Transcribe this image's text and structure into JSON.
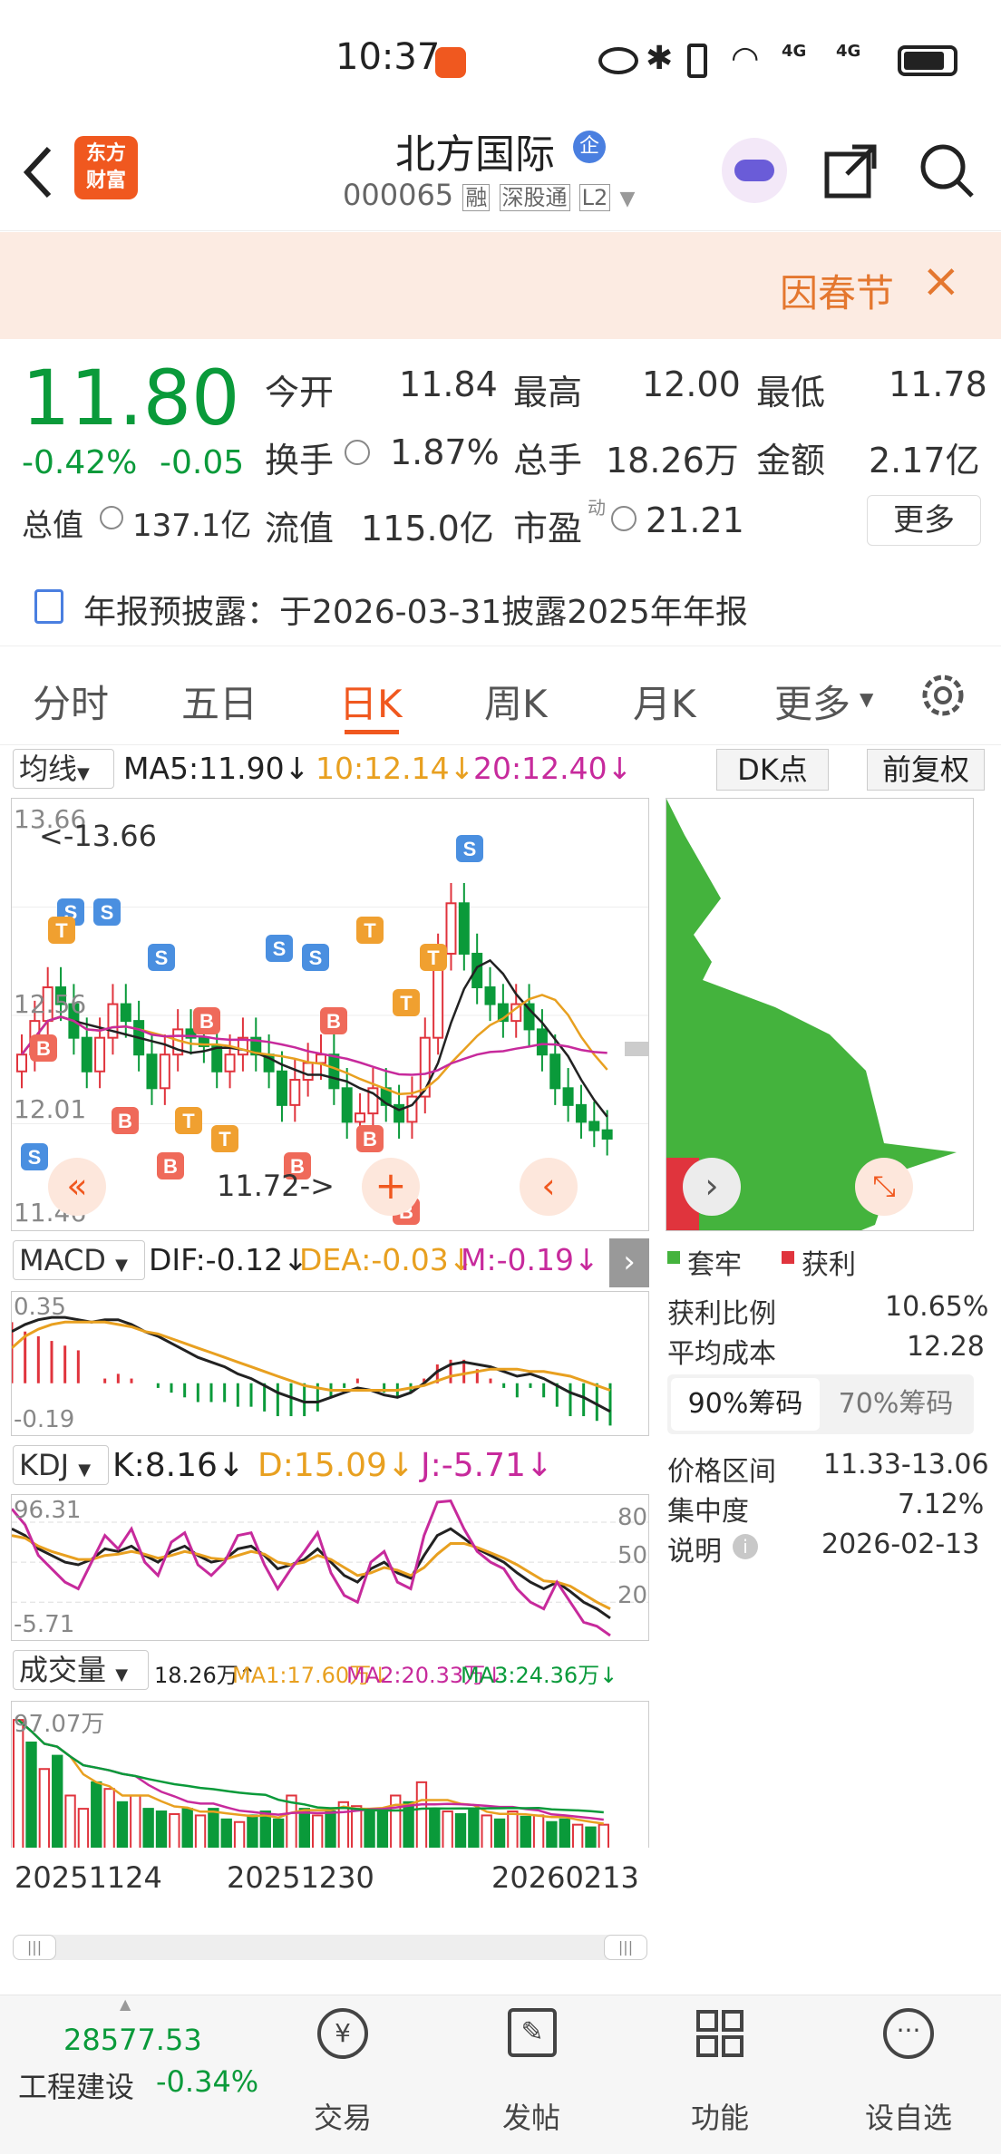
{
  "status_bar": {
    "time": "10:37",
    "signal_labels": [
      "4G",
      "4G"
    ]
  },
  "header": {
    "app_logo": [
      "东方",
      "财富"
    ],
    "stock_name": "北方国际",
    "enterprise_badge": "企",
    "stock_code": "000065",
    "tags": [
      "融",
      "深股通",
      "L2"
    ]
  },
  "notice": {
    "text": "因春节",
    "close": "×"
  },
  "quote": {
    "price": "11.80",
    "change_pct": "-0.42%",
    "change": "-0.05",
    "fields": {
      "open_label": "今开",
      "open": "11.84",
      "high_label": "最高",
      "high": "12.00",
      "low_label": "最低",
      "low": "11.78",
      "turnover_label": "换手",
      "turnover": "1.87%",
      "volume_label": "总手",
      "volume": "18.26万",
      "amount_label": "金额",
      "amount": "2.17亿",
      "mcap_label": "总值",
      "mcap": "137.1亿",
      "float_label": "流值",
      "float": "115.0亿",
      "pe_label": "市盈",
      "pe_sup": "动",
      "pe": "21.21"
    },
    "more_button": "更多"
  },
  "report": {
    "text": "年报预披露：于2026-03-31披露2025年年报"
  },
  "tabs": [
    {
      "label": "分时",
      "active": false
    },
    {
      "label": "五日",
      "active": false
    },
    {
      "label": "日K",
      "active": true
    },
    {
      "label": "周K",
      "active": false
    },
    {
      "label": "月K",
      "active": false
    },
    {
      "label": "更多",
      "active": false
    }
  ],
  "ma_bar": {
    "selector": "均线",
    "ma5": "MA5:11.90↓",
    "ma10": "10:12.14↓",
    "ma20": "20:12.40↓",
    "dk_button": "DK点",
    "adjust_button": "前复权"
  },
  "kline": {
    "top_label": "13.66",
    "max_marker": "<-13.66",
    "mid_label": "12.56",
    "low_mid_label": "12.01",
    "bottom_label": "11.46",
    "cursor_label": "11.72->",
    "signal_s": "S",
    "signal_b": "B",
    "signal_t": "T"
  },
  "chips": {
    "legend_trapped": "套牢",
    "legend_profit": "获利",
    "profit_ratio_label": "获利比例",
    "profit_ratio": "10.65%",
    "avg_cost_label": "平均成本",
    "avg_cost": "12.28",
    "tab90": "90%筹码",
    "tab70": "70%筹码",
    "range_label": "价格区间",
    "range": "11.33-13.06",
    "conc_label": "集中度",
    "conc": "7.12%",
    "note_label": "说明",
    "note": "2026-02-13"
  },
  "macd": {
    "selector": "MACD",
    "dif": "DIF:-0.12↓",
    "dea": "DEA:-0.03↓",
    "m": "M:-0.19↓",
    "top": "0.35",
    "bottom": "-0.19",
    "dif_line": [
      0.22,
      0.25,
      0.27,
      0.28,
      0.28,
      0.27,
      0.26,
      0.27,
      0.27,
      0.25,
      0.22,
      0.2,
      0.17,
      0.14,
      0.11,
      0.09,
      0.07,
      0.04,
      0.02,
      -0.01,
      -0.04,
      -0.06,
      -0.08,
      -0.08,
      -0.06,
      -0.04,
      -0.02,
      -0.03,
      -0.05,
      -0.06,
      -0.04,
      0.0,
      0.05,
      0.08,
      0.09,
      0.08,
      0.07,
      0.05,
      0.03,
      0.04,
      0.02,
      -0.01,
      -0.04,
      -0.06,
      -0.09,
      -0.12
    ],
    "dea_line": [
      0.15,
      0.2,
      0.23,
      0.25,
      0.26,
      0.26,
      0.26,
      0.26,
      0.25,
      0.24,
      0.22,
      0.21,
      0.19,
      0.17,
      0.15,
      0.13,
      0.11,
      0.09,
      0.07,
      0.05,
      0.03,
      0.01,
      -0.01,
      -0.02,
      -0.03,
      -0.03,
      -0.03,
      -0.03,
      -0.03,
      -0.03,
      -0.02,
      -0.01,
      0.01,
      0.03,
      0.04,
      0.05,
      0.06,
      0.06,
      0.06,
      0.05,
      0.05,
      0.04,
      0.03,
      0.01,
      -0.01,
      -0.03
    ]
  },
  "kdj": {
    "selector": "KDJ",
    "k": "K:8.16↓",
    "d": "D:15.09↓",
    "j": "J:-5.71↓",
    "top": "96.31",
    "bottom": "-5.71",
    "levels": [
      "80",
      "50",
      "20"
    ],
    "k_line": [
      75,
      70,
      60,
      55,
      50,
      48,
      52,
      60,
      58,
      62,
      55,
      50,
      58,
      62,
      55,
      50,
      52,
      60,
      62,
      55,
      45,
      48,
      52,
      60,
      50,
      40,
      35,
      45,
      50,
      42,
      38,
      55,
      70,
      75,
      68,
      60,
      55,
      50,
      42,
      35,
      30,
      35,
      28,
      20,
      15,
      8
    ],
    "d_line": [
      70,
      68,
      62,
      58,
      55,
      52,
      52,
      55,
      56,
      58,
      56,
      53,
      55,
      58,
      56,
      53,
      52,
      55,
      58,
      56,
      50,
      48,
      50,
      55,
      52,
      46,
      40,
      42,
      46,
      44,
      40,
      46,
      56,
      64,
      64,
      61,
      57,
      53,
      48,
      42,
      36,
      35,
      32,
      26,
      20,
      15
    ],
    "j_line": [
      90,
      78,
      55,
      45,
      35,
      30,
      50,
      70,
      60,
      75,
      50,
      40,
      65,
      72,
      48,
      40,
      50,
      70,
      72,
      48,
      30,
      45,
      58,
      72,
      42,
      25,
      20,
      50,
      58,
      35,
      30,
      70,
      95,
      96,
      75,
      58,
      50,
      45,
      30,
      20,
      15,
      35,
      20,
      5,
      2,
      -5
    ]
  },
  "volume": {
    "selector": "成交量",
    "vol": "18.26万↑",
    "ma1": "MA1:17.60万↓",
    "ma2": "MA2:20.33万↓",
    "ma3": "MA3:24.36万↓",
    "top": "97.07万",
    "dates": [
      "20251124",
      "20251230",
      "20260213"
    ]
  },
  "bottom_nav": {
    "index_value": "28577.53",
    "index_name": "工程建设",
    "index_change": "-0.34%",
    "items": [
      "交易",
      "发帖",
      "功能",
      "设自选"
    ]
  }
}
